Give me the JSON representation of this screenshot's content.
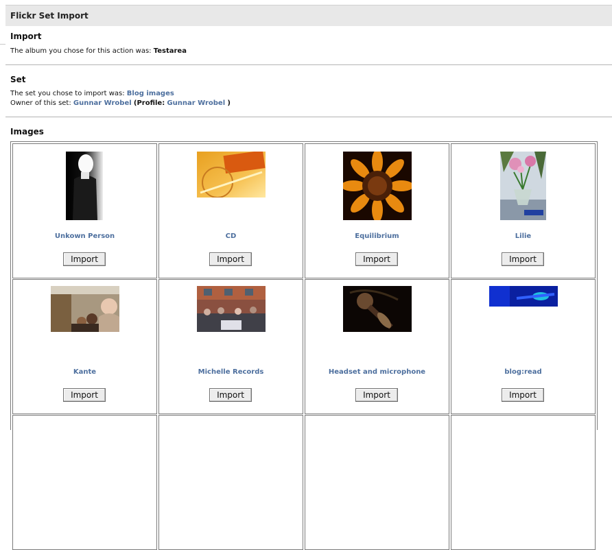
{
  "header": {
    "title": "Flickr Set Import"
  },
  "import_section": {
    "title": "Import",
    "text": "The album you chose for this action was:",
    "album": "Testarea"
  },
  "set_section": {
    "title": "Set",
    "set_text": "The set you chose to import was:",
    "set_name": "Blog images",
    "owner_text": "Owner of this set:",
    "owner_name": "Gunnar Wrobel",
    "profile_label": "(Profile:",
    "profile_name": "Gunnar Wrobel",
    "profile_close": ")"
  },
  "images_section": {
    "title": "Images",
    "items": [
      {
        "caption": "Unkown Person",
        "button": "Import"
      },
      {
        "caption": "CD",
        "button": "Import"
      },
      {
        "caption": "Equilibrium",
        "button": "Import"
      },
      {
        "caption": "Lilie",
        "button": "Import"
      },
      {
        "caption": "Kante",
        "button": "Import"
      },
      {
        "caption": "Michelle Records",
        "button": "Import"
      },
      {
        "caption": "Headset and microphone",
        "button": "Import"
      },
      {
        "caption": "blog:read",
        "button": "Import"
      }
    ]
  }
}
